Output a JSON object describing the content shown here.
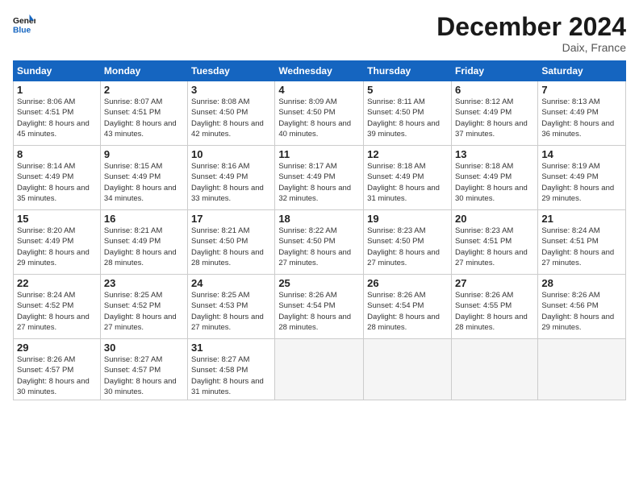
{
  "logo": {
    "line1": "General",
    "line2": "Blue"
  },
  "title": "December 2024",
  "location": "Daix, France",
  "days_header": [
    "Sunday",
    "Monday",
    "Tuesday",
    "Wednesday",
    "Thursday",
    "Friday",
    "Saturday"
  ],
  "weeks": [
    [
      {
        "day": "1",
        "sunrise": "8:06 AM",
        "sunset": "4:51 PM",
        "daylight": "8 hours and 45 minutes."
      },
      {
        "day": "2",
        "sunrise": "8:07 AM",
        "sunset": "4:51 PM",
        "daylight": "8 hours and 43 minutes."
      },
      {
        "day": "3",
        "sunrise": "8:08 AM",
        "sunset": "4:50 PM",
        "daylight": "8 hours and 42 minutes."
      },
      {
        "day": "4",
        "sunrise": "8:09 AM",
        "sunset": "4:50 PM",
        "daylight": "8 hours and 40 minutes."
      },
      {
        "day": "5",
        "sunrise": "8:11 AM",
        "sunset": "4:50 PM",
        "daylight": "8 hours and 39 minutes."
      },
      {
        "day": "6",
        "sunrise": "8:12 AM",
        "sunset": "4:49 PM",
        "daylight": "8 hours and 37 minutes."
      },
      {
        "day": "7",
        "sunrise": "8:13 AM",
        "sunset": "4:49 PM",
        "daylight": "8 hours and 36 minutes."
      }
    ],
    [
      {
        "day": "8",
        "sunrise": "8:14 AM",
        "sunset": "4:49 PM",
        "daylight": "8 hours and 35 minutes."
      },
      {
        "day": "9",
        "sunrise": "8:15 AM",
        "sunset": "4:49 PM",
        "daylight": "8 hours and 34 minutes."
      },
      {
        "day": "10",
        "sunrise": "8:16 AM",
        "sunset": "4:49 PM",
        "daylight": "8 hours and 33 minutes."
      },
      {
        "day": "11",
        "sunrise": "8:17 AM",
        "sunset": "4:49 PM",
        "daylight": "8 hours and 32 minutes."
      },
      {
        "day": "12",
        "sunrise": "8:18 AM",
        "sunset": "4:49 PM",
        "daylight": "8 hours and 31 minutes."
      },
      {
        "day": "13",
        "sunrise": "8:18 AM",
        "sunset": "4:49 PM",
        "daylight": "8 hours and 30 minutes."
      },
      {
        "day": "14",
        "sunrise": "8:19 AM",
        "sunset": "4:49 PM",
        "daylight": "8 hours and 29 minutes."
      }
    ],
    [
      {
        "day": "15",
        "sunrise": "8:20 AM",
        "sunset": "4:49 PM",
        "daylight": "8 hours and 29 minutes."
      },
      {
        "day": "16",
        "sunrise": "8:21 AM",
        "sunset": "4:49 PM",
        "daylight": "8 hours and 28 minutes."
      },
      {
        "day": "17",
        "sunrise": "8:21 AM",
        "sunset": "4:50 PM",
        "daylight": "8 hours and 28 minutes."
      },
      {
        "day": "18",
        "sunrise": "8:22 AM",
        "sunset": "4:50 PM",
        "daylight": "8 hours and 27 minutes."
      },
      {
        "day": "19",
        "sunrise": "8:23 AM",
        "sunset": "4:50 PM",
        "daylight": "8 hours and 27 minutes."
      },
      {
        "day": "20",
        "sunrise": "8:23 AM",
        "sunset": "4:51 PM",
        "daylight": "8 hours and 27 minutes."
      },
      {
        "day": "21",
        "sunrise": "8:24 AM",
        "sunset": "4:51 PM",
        "daylight": "8 hours and 27 minutes."
      }
    ],
    [
      {
        "day": "22",
        "sunrise": "8:24 AM",
        "sunset": "4:52 PM",
        "daylight": "8 hours and 27 minutes."
      },
      {
        "day": "23",
        "sunrise": "8:25 AM",
        "sunset": "4:52 PM",
        "daylight": "8 hours and 27 minutes."
      },
      {
        "day": "24",
        "sunrise": "8:25 AM",
        "sunset": "4:53 PM",
        "daylight": "8 hours and 27 minutes."
      },
      {
        "day": "25",
        "sunrise": "8:26 AM",
        "sunset": "4:54 PM",
        "daylight": "8 hours and 28 minutes."
      },
      {
        "day": "26",
        "sunrise": "8:26 AM",
        "sunset": "4:54 PM",
        "daylight": "8 hours and 28 minutes."
      },
      {
        "day": "27",
        "sunrise": "8:26 AM",
        "sunset": "4:55 PM",
        "daylight": "8 hours and 28 minutes."
      },
      {
        "day": "28",
        "sunrise": "8:26 AM",
        "sunset": "4:56 PM",
        "daylight": "8 hours and 29 minutes."
      }
    ],
    [
      {
        "day": "29",
        "sunrise": "8:26 AM",
        "sunset": "4:57 PM",
        "daylight": "8 hours and 30 minutes."
      },
      {
        "day": "30",
        "sunrise": "8:27 AM",
        "sunset": "4:57 PM",
        "daylight": "8 hours and 30 minutes."
      },
      {
        "day": "31",
        "sunrise": "8:27 AM",
        "sunset": "4:58 PM",
        "daylight": "8 hours and 31 minutes."
      },
      null,
      null,
      null,
      null
    ]
  ]
}
